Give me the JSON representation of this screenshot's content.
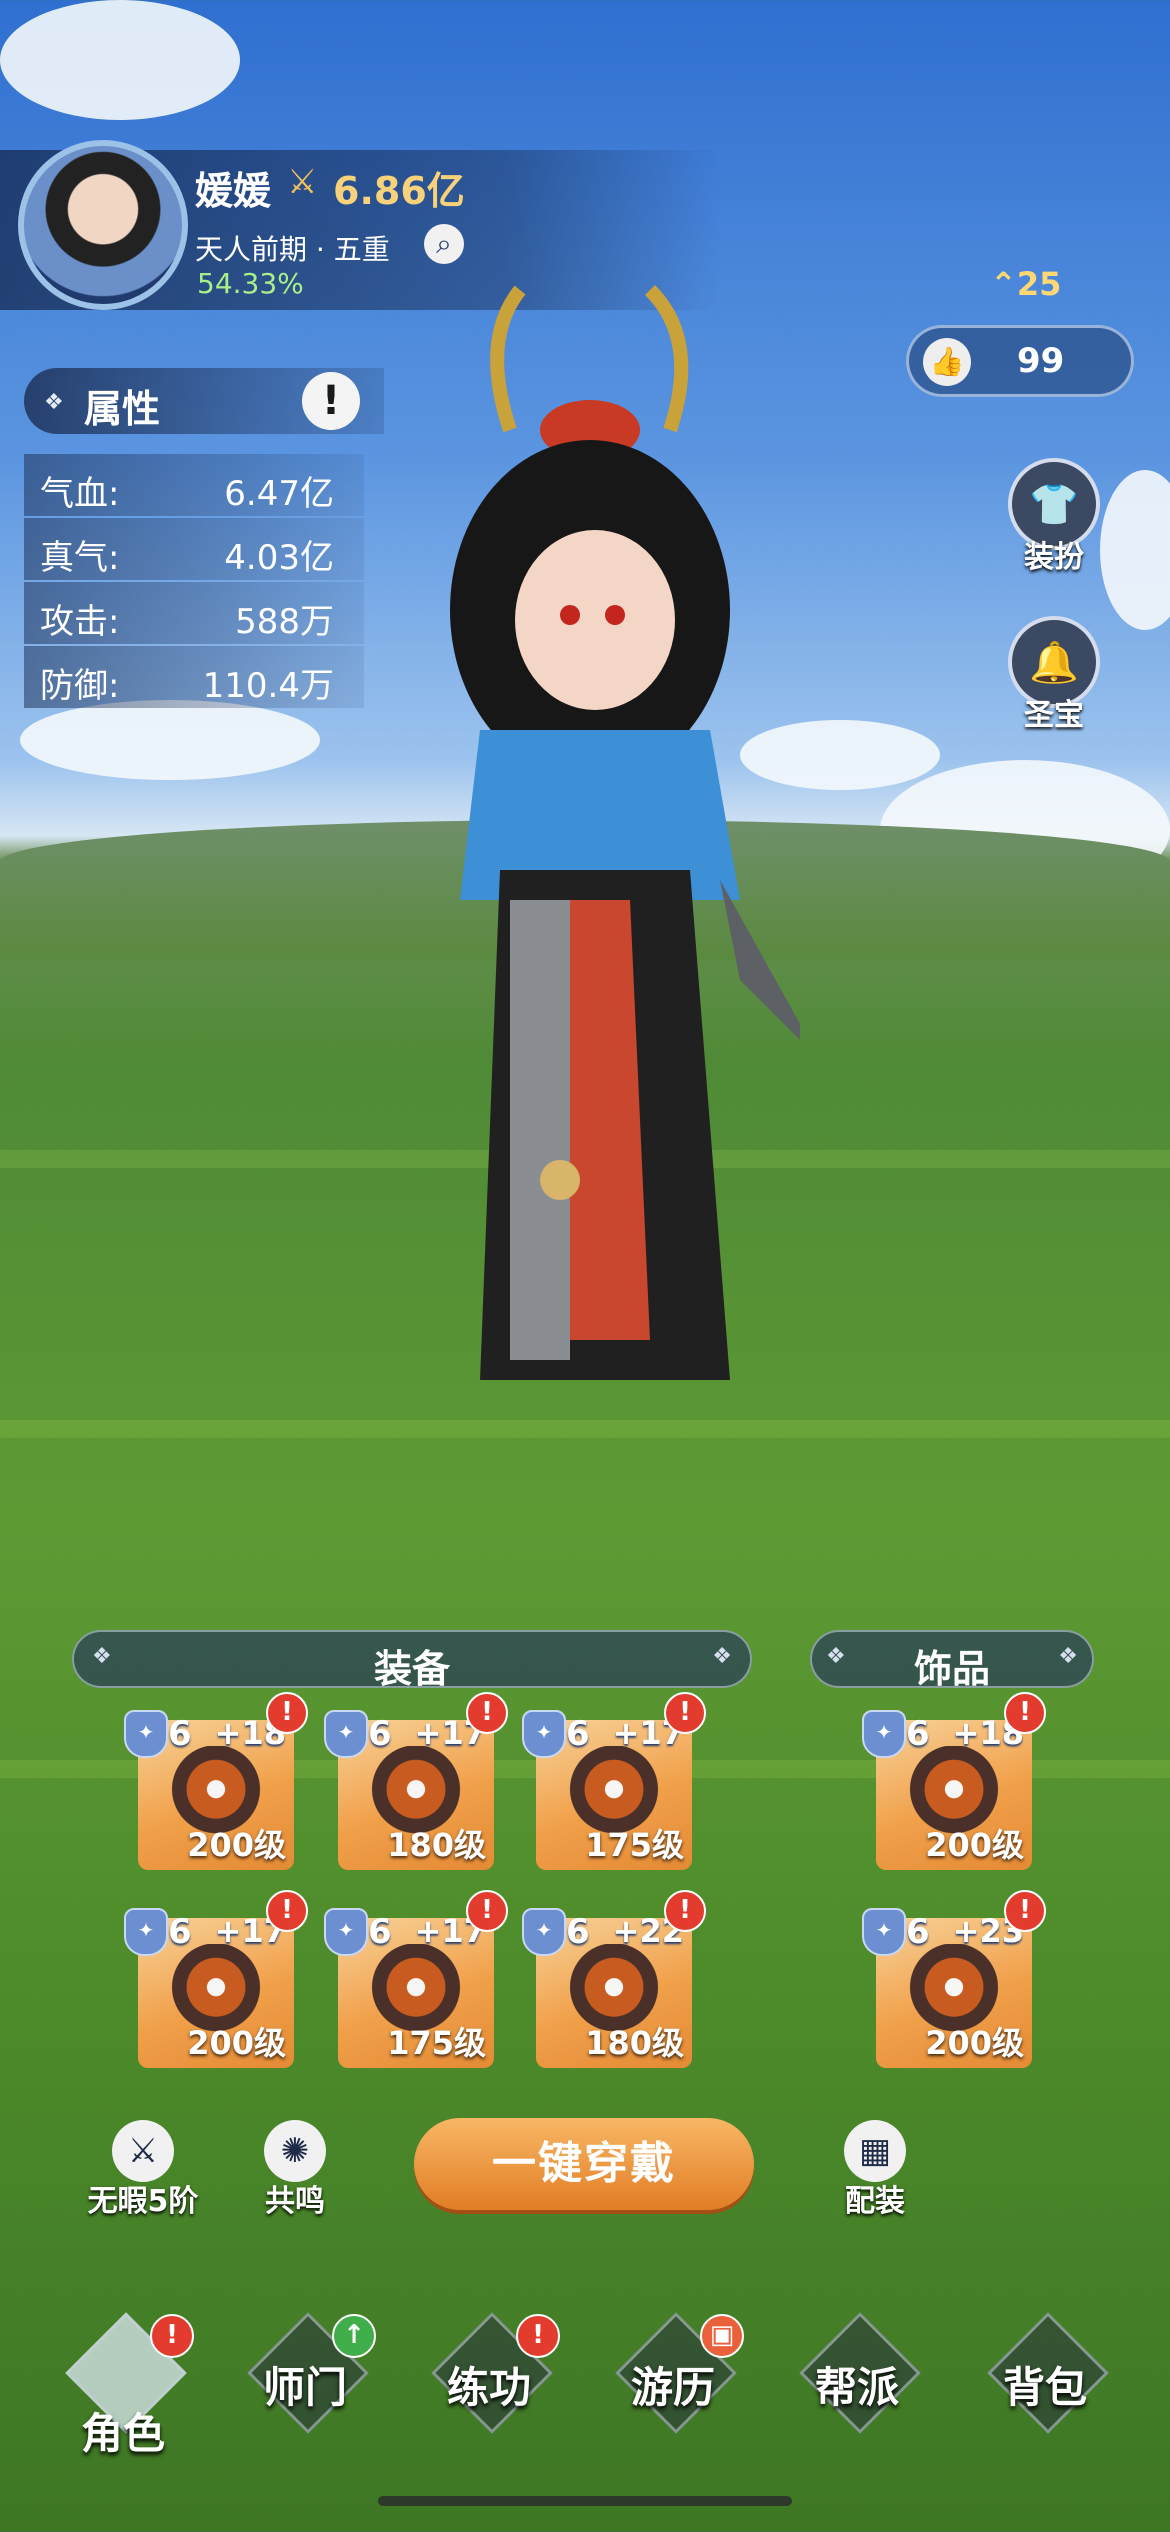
{
  "player": {
    "name": "媛媛",
    "power": "6.86亿",
    "realm": "天人前期 · 五重",
    "progress": "54.33%",
    "rank": "25",
    "likes": "99"
  },
  "side_buttons": {
    "outfit": "装扮",
    "treasure": "圣宝"
  },
  "attributes": {
    "title": "属性",
    "info_icon": "!",
    "rows": [
      {
        "label": "气血:",
        "value": "6.47亿"
      },
      {
        "label": "真气:",
        "value": "4.03亿"
      },
      {
        "label": "攻击:",
        "value": "588万"
      },
      {
        "label": "防御:",
        "value": "110.4万"
      }
    ]
  },
  "equipment": {
    "title": "装备",
    "slots": [
      {
        "tier": "6",
        "plus": "+18",
        "level": "200级"
      },
      {
        "tier": "6",
        "plus": "+17",
        "level": "180级"
      },
      {
        "tier": "6",
        "plus": "+17",
        "level": "175级"
      },
      {
        "tier": "6",
        "plus": "+17",
        "level": "200级"
      },
      {
        "tier": "6",
        "plus": "+17",
        "level": "175级"
      },
      {
        "tier": "6",
        "plus": "+22",
        "level": "180级"
      }
    ]
  },
  "accessories": {
    "title": "饰品",
    "slots": [
      {
        "tier": "6",
        "plus": "+18",
        "level": "200级"
      },
      {
        "tier": "6",
        "plus": "+23",
        "level": "200级"
      }
    ]
  },
  "actions": {
    "wuxia": "无暇5阶",
    "resonance": "共鸣",
    "equip_all": "一键穿戴",
    "loadout": "配装"
  },
  "nav": [
    {
      "label": "角色",
      "badge": "!",
      "badge_color": "#e43b2f"
    },
    {
      "label": "师门",
      "badge": "↑",
      "badge_color": "#3fae4b"
    },
    {
      "label": "练功",
      "badge": "!",
      "badge_color": "#e43b2f"
    },
    {
      "label": "游历",
      "badge": "▣",
      "badge_color": "#e9603a"
    },
    {
      "label": "帮派",
      "badge": "",
      "badge_color": ""
    },
    {
      "label": "背包",
      "badge": "",
      "badge_color": ""
    }
  ],
  "colors": {
    "gold": "#f7d27a",
    "green": "#a8ef8a",
    "orange_btn": "#e17d25"
  },
  "icons": [
    "search-icon",
    "thumbs-up-icon",
    "info-icon",
    "shield-star-icon",
    "alert-icon",
    "grid-icon"
  ]
}
